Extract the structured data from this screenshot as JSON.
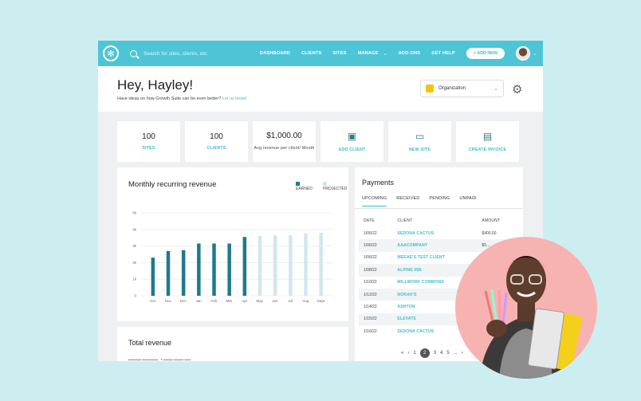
{
  "topbar": {
    "search_placeholder": "Search for sites, clients, etc.",
    "nav": [
      "DASHBOARD",
      "CLIENTS",
      "SITES",
      "MANAGE",
      "ADD-ONS",
      "GET HELP"
    ],
    "add_new": "+ ADD NEW"
  },
  "header": {
    "greeting": "Hey, Hayley!",
    "subtext": "Have ideas on how Growth Suite can be even better?",
    "subtext_link": "Let us know!",
    "org_select": "Organization"
  },
  "cards": [
    {
      "num": "100",
      "label": "SITES"
    },
    {
      "num": "100",
      "label": "CLIENTS"
    },
    {
      "num": "$1,000.00",
      "label": "Avg revenue per client/ Month"
    },
    {
      "label": "ADD CLIENT"
    },
    {
      "label": "NEW SITE"
    },
    {
      "label": "CREATE INVOICE"
    }
  ],
  "revenue": {
    "title": "Monthly recurring revenue",
    "legend_earned": "EARNED",
    "legend_projected": "PROJECTED"
  },
  "chart_data": {
    "type": "bar",
    "categories": [
      "Oct",
      "Nov",
      "Dec",
      "Jan",
      "Feb",
      "Mar",
      "Apr",
      "May",
      "Jun",
      "Jul",
      "Aug",
      "Sept"
    ],
    "series": [
      {
        "name": "EARNED",
        "values": [
          2.3,
          2.7,
          2.75,
          3.15,
          3.15,
          3.15,
          3.55,
          null,
          null,
          null,
          null,
          null
        ]
      },
      {
        "name": "PROJECTED",
        "values": [
          null,
          null,
          null,
          null,
          null,
          null,
          null,
          3.6,
          3.65,
          3.65,
          3.75,
          3.8
        ]
      }
    ],
    "yticks": [
      "0",
      "1k",
      "2k",
      "3k",
      "4k",
      "5k"
    ],
    "ylim": [
      0,
      5
    ],
    "colors": {
      "earned": "#1f7a8c",
      "projected": "#cfe8ee"
    }
  },
  "payments": {
    "title": "Payments",
    "tabs": [
      "UPCOMING",
      "RECEIVED",
      "PENDING",
      "UNPAID"
    ],
    "columns": [
      "DATE",
      "CLIENT",
      "AMOUNT"
    ],
    "rows": [
      [
        "1/05/22",
        "SEDONA CACTUS",
        "$400.00"
      ],
      [
        "1/06/22",
        "AAACOMPANY",
        "$5..."
      ],
      [
        "1/06/22",
        "MEEAE'S TEST CLIENT",
        ""
      ],
      [
        "1/08/22",
        "ALPINE INN",
        ""
      ],
      [
        "1/10/22",
        "MILLWORK COMMONS",
        ""
      ],
      [
        "1/12/22",
        "NORAH'S",
        ""
      ],
      [
        "1/14/22",
        "ASHTON",
        ""
      ],
      [
        "1/15/22",
        "ELEVATE",
        ""
      ],
      [
        "1/16/22",
        "SEDONA CACTUS",
        ""
      ]
    ],
    "pager": {
      "first": "«",
      "prev": "‹",
      "pages": [
        "1",
        "2",
        "3",
        "4",
        "5"
      ],
      "current": "2",
      "ellipsis": "...",
      "next": "›"
    }
  },
  "total": {
    "title": "Total revenue"
  },
  "icons": {
    "logo": "logo-icon",
    "search": "search-icon",
    "gear": "gear-icon"
  }
}
